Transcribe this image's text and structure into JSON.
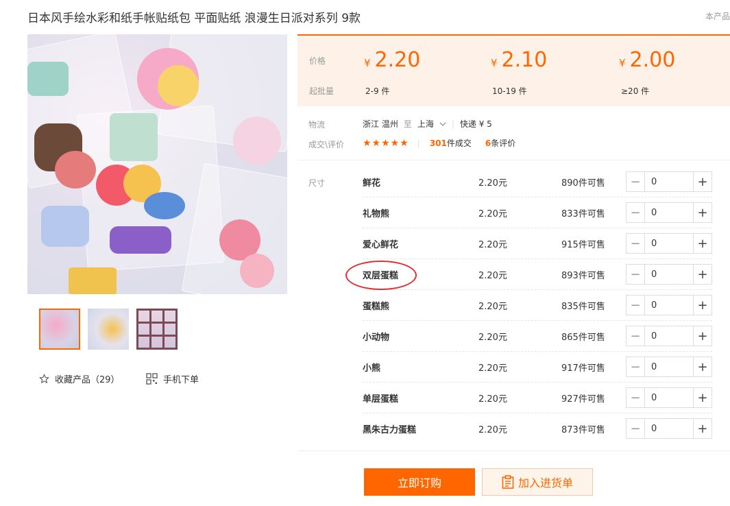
{
  "product": {
    "title": "日本风手绘水彩和纸手帐贴纸包 平面贴纸 浪漫生日派对系列 9款",
    "corner_text": "本产品"
  },
  "gallery": {
    "thumbnail_count": 3,
    "active_thumbnail": 1
  },
  "actions": {
    "favorite_label": "收藏产品（29）",
    "mobile_order_label": "手机下单"
  },
  "pricing": {
    "price_label": "价格",
    "moq_label": "起批量",
    "currency": "¥",
    "tiers": [
      {
        "price": "2.20",
        "range": "2-9 件"
      },
      {
        "price": "2.10",
        "range": "10-19 件"
      },
      {
        "price": "2.00",
        "range": "≥20 件"
      }
    ]
  },
  "logistics": {
    "label": "物流",
    "from": "浙江 温州",
    "to_word": "至",
    "to": "上海",
    "shipping": "快递 ¥ 5"
  },
  "reviews": {
    "label": "成交\\评价",
    "stars": "★★★★★",
    "deals_count": "301",
    "deals_suffix": "件成交",
    "review_count": "6",
    "review_suffix": "条评价"
  },
  "sku": {
    "label": "尺寸",
    "rows": [
      {
        "name": "鲜花",
        "price": "2.20元",
        "stock": "890件可售",
        "qty": "0"
      },
      {
        "name": "礼物熊",
        "price": "2.20元",
        "stock": "833件可售",
        "qty": "0"
      },
      {
        "name": "爱心鲜花",
        "price": "2.20元",
        "stock": "915件可售",
        "qty": "0"
      },
      {
        "name": "双层蛋糕",
        "price": "2.20元",
        "stock": "893件可售",
        "qty": "0"
      },
      {
        "name": "蛋糕熊",
        "price": "2.20元",
        "stock": "835件可售",
        "qty": "0"
      },
      {
        "name": "小动物",
        "price": "2.20元",
        "stock": "865件可售",
        "qty": "0"
      },
      {
        "name": "小熊",
        "price": "2.20元",
        "stock": "917件可售",
        "qty": "0"
      },
      {
        "name": "单层蛋糕",
        "price": "2.20元",
        "stock": "927件可售",
        "qty": "0"
      },
      {
        "name": "黑朱古力蛋糕",
        "price": "2.20元",
        "stock": "873件可售",
        "qty": "0"
      }
    ],
    "minus_symbol": "−",
    "plus_symbol": "+"
  },
  "buttons": {
    "buy_now": "立即订购",
    "add_to_cart": "加入进货单"
  },
  "colors": {
    "accent": "#ff6600",
    "price_bg": "#fef2e8",
    "highlight_ring": "#e03030"
  }
}
